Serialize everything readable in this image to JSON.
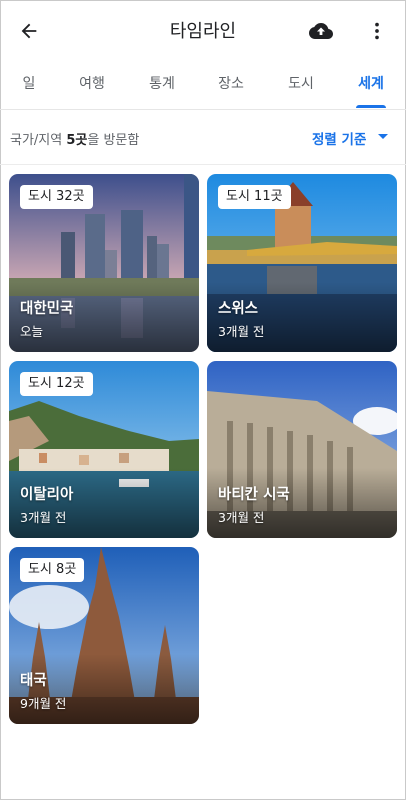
{
  "header": {
    "title": "타임라인",
    "back_icon": "arrow-back-icon",
    "upload_icon": "cloud-upload-icon",
    "more_icon": "more-vert-icon"
  },
  "tabs": [
    {
      "label": "일",
      "active": false
    },
    {
      "label": "여행",
      "active": false
    },
    {
      "label": "통계",
      "active": false
    },
    {
      "label": "장소",
      "active": false
    },
    {
      "label": "도시",
      "active": false
    },
    {
      "label": "세계",
      "active": true
    }
  ],
  "summary": {
    "prefix": "국가/지역 ",
    "count": "5곳",
    "suffix": "을 방문함",
    "sort_label": "정렬 기준"
  },
  "countries": [
    {
      "badge": "도시 32곳",
      "name": "대한민국",
      "when": "오늘"
    },
    {
      "badge": "도시 11곳",
      "name": "스위스",
      "when": "3개월 전"
    },
    {
      "badge": "도시 12곳",
      "name": "이탈리아",
      "when": "3개월 전"
    },
    {
      "badge": "",
      "name": "바티칸 시국",
      "when": "3개월 전"
    },
    {
      "badge": "도시 8곳",
      "name": "태국",
      "when": "9개월 전"
    }
  ],
  "colors": {
    "accent": "#1a73e8",
    "text_primary": "#202124",
    "text_secondary": "#5f6368"
  }
}
